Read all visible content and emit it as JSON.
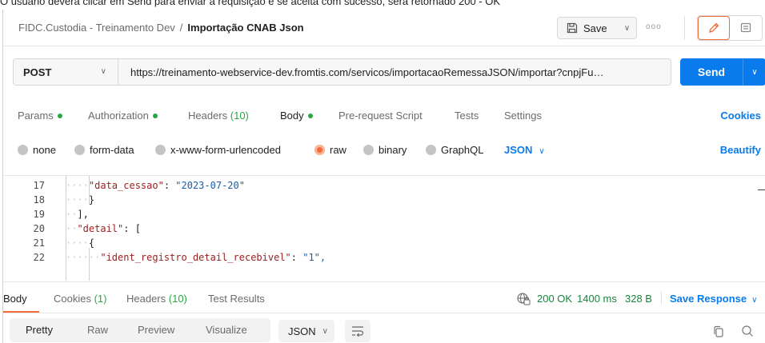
{
  "caption": "O usuário deverá clicar em Send para enviar a requisição e se aceita com sucesso, será retornado 200 - OK",
  "header": {
    "collection": "FIDC.Custodia - Treinamento Dev",
    "separator": "/",
    "request_name": "Importação CNAB Json",
    "save_label": "Save",
    "more_label": "ooo"
  },
  "request": {
    "method": "POST",
    "url": "https://treinamento-webservice-dev.fromtis.com/servicos/importacaoRemessaJSON/importar?cnpjFu…",
    "send_label": "Send"
  },
  "request_tabs": {
    "params": "Params",
    "authorization": "Authorization",
    "headers": "Headers",
    "headers_count": "(10)",
    "body": "Body",
    "prerequest": "Pre-request Script",
    "tests": "Tests",
    "settings": "Settings",
    "cookies": "Cookies",
    "active": "Body"
  },
  "body_types": {
    "none": "none",
    "form_data": "form-data",
    "urlencoded": "x-www-form-urlencoded",
    "raw": "raw",
    "binary": "binary",
    "graphql": "GraphQL",
    "selected": "raw",
    "language": "JSON",
    "beautify": "Beautify"
  },
  "editor": {
    "line_numbers": [
      "17",
      "18",
      "19",
      "20",
      "21",
      "22"
    ],
    "lines": [
      {
        "indent": "····",
        "key": "\"data_cessao\"",
        "sep": ": ",
        "value": "\"2023-07-20\""
      },
      {
        "indent": "····",
        "key": "",
        "sep": "",
        "value": "}"
      },
      {
        "indent": "··",
        "key": "",
        "sep": "",
        "value": "],"
      },
      {
        "indent": "··",
        "key": "\"detail\"",
        "sep": ": ",
        "value": "["
      },
      {
        "indent": "····",
        "key": "",
        "sep": "",
        "value": "{"
      },
      {
        "indent": "······",
        "key": "\"ident_registro_detail_recebivel\"",
        "sep": ": ",
        "value": "\"1\","
      }
    ]
  },
  "response_tabs": {
    "body": "Body",
    "cookies": "Cookies",
    "cookies_count": "(1)",
    "headers": "Headers",
    "headers_count": "(10)",
    "test_results": "Test Results",
    "active": "Body"
  },
  "response_status": {
    "status": "200 OK",
    "time": "1400 ms",
    "size": "328 B",
    "save_response": "Save Response"
  },
  "response_format": {
    "pretty": "Pretty",
    "raw": "Raw",
    "preview": "Preview",
    "visualize": "Visualize",
    "active": "Pretty",
    "language": "JSON"
  },
  "colors": {
    "accent_orange": "#f26b3a",
    "primary_blue": "#097bed",
    "success_green": "#27a844"
  }
}
